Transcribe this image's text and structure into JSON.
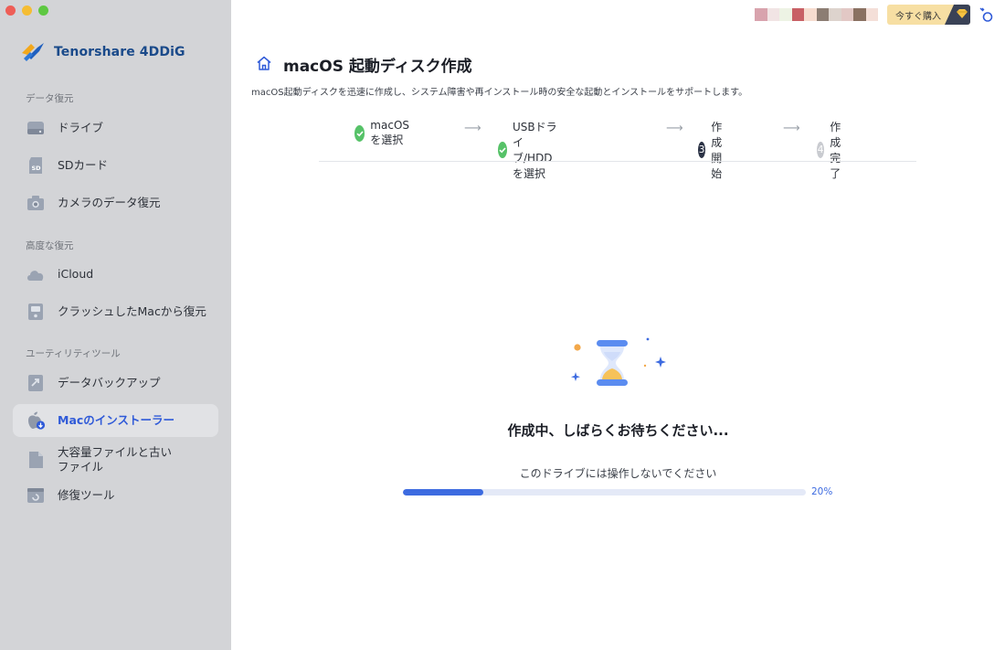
{
  "app": {
    "name": "Tenorshare 4DDiG"
  },
  "sidebar": {
    "sections": [
      {
        "title": "データ復元"
      },
      {
        "title": "高度な復元"
      },
      {
        "title": "ユーティリティツール"
      }
    ],
    "items": [
      {
        "label": "ドライブ",
        "icon": "drive-icon"
      },
      {
        "label": "SDカード",
        "icon": "sd-card-icon"
      },
      {
        "label": "カメラのデータ復元",
        "icon": "camera-icon"
      },
      {
        "label": "iCloud",
        "icon": "cloud-icon"
      },
      {
        "label": "クラッシュしたMacから復元",
        "icon": "crashed-mac-icon"
      },
      {
        "label": "データバックアップ",
        "icon": "backup-icon"
      },
      {
        "label": "Macのインストーラー",
        "icon": "apple-installer-icon",
        "active": true
      },
      {
        "label": "大容量ファイルと古いファイル",
        "icon": "file-icon"
      },
      {
        "label": "修復ツール",
        "icon": "repair-icon"
      }
    ]
  },
  "topbar": {
    "buy_label": "今すぐ購入",
    "swatch_colors": [
      "#d8a3ad",
      "#f1e4e4",
      "#edf3e4",
      "#c86065",
      "#f6dccf",
      "#8c7d73",
      "#ddd3cd",
      "#e2c8c5",
      "#8a7162",
      "#f4dfd8"
    ]
  },
  "page": {
    "title": "macOS 起動ディスク作成",
    "description": "macOS起動ディスクを迅速に作成し、システム障害や再インストール時の安全な起動とインストールをサポートします。"
  },
  "steps": [
    {
      "number": "",
      "label": "macOSを選択",
      "state": "done"
    },
    {
      "number": "",
      "label": "USBドライブ/HDDを選択",
      "state": "done"
    },
    {
      "number": "3",
      "label": "作成開始",
      "state": "current"
    },
    {
      "number": "4",
      "label": "作成完了",
      "state": "todo"
    }
  ],
  "status": {
    "title": "作成中、しばらくお待ちください...",
    "subtitle": "このドライブには操作しないでください",
    "progress_percent": 20,
    "progress_text": "20%"
  },
  "colors": {
    "accent": "#3d6be0",
    "sidebar_bg": "#d3d4d7",
    "done": "#56c268"
  }
}
